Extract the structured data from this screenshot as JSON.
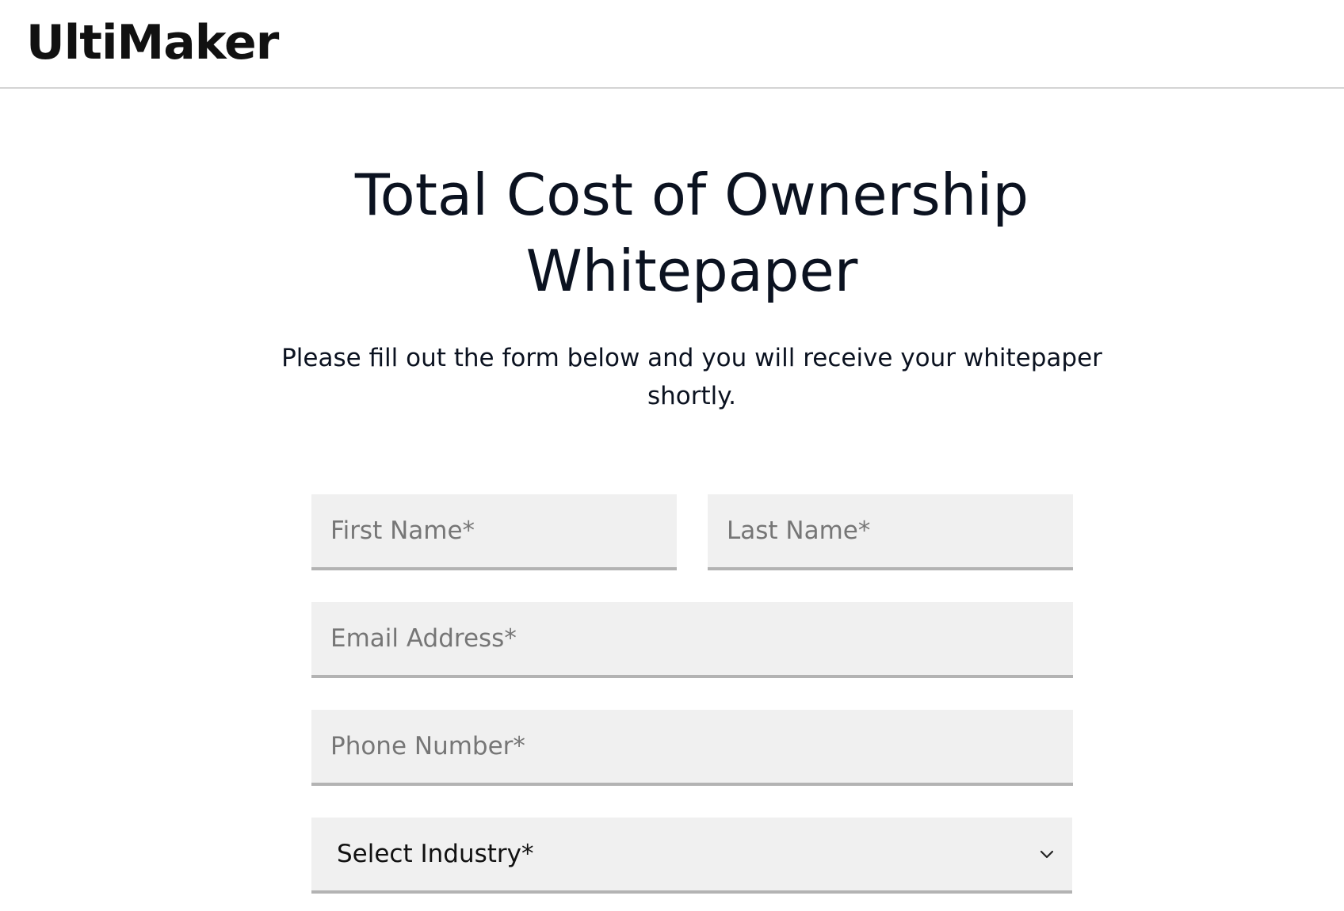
{
  "header": {
    "logo_text": "UltiMaker"
  },
  "main": {
    "title_line1": "Total Cost of Ownership",
    "title_line2": "Whitepaper",
    "subtitle_line1": "Please fill out the form below and you will receive your whitepaper",
    "subtitle_line2": "shortly."
  },
  "form": {
    "first_name": {
      "value": "",
      "placeholder": "First Name*"
    },
    "last_name": {
      "value": "",
      "placeholder": "Last Name*"
    },
    "email": {
      "value": "",
      "placeholder": "Email Address*"
    },
    "phone": {
      "value": "",
      "placeholder": "Phone Number*"
    },
    "industry": {
      "selected": "Select Industry*",
      "icon": "chevron-down-icon"
    }
  }
}
